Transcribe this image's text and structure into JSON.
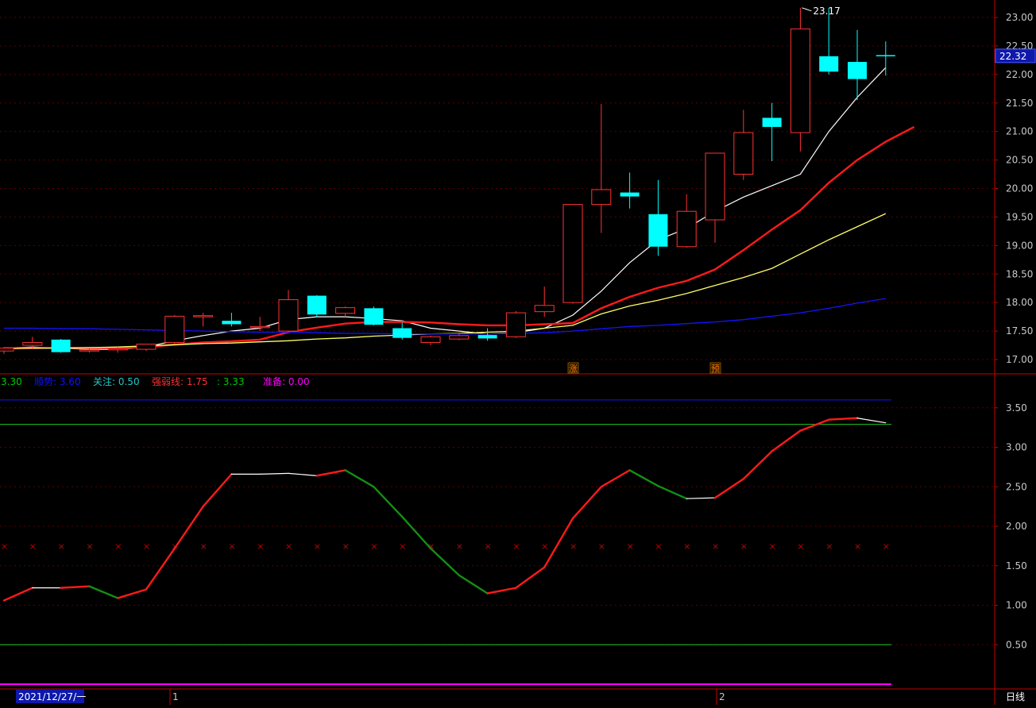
{
  "price_axis_ticks": [
    "23.00",
    "22.50",
    "22.00",
    "21.50",
    "21.00",
    "20.50",
    "20.00",
    "19.50",
    "19.00",
    "18.50",
    "18.00",
    "17.50",
    "17.00"
  ],
  "current_price_label": "22.32",
  "high_annotation": "23.17",
  "candle_markers": [
    {
      "label": "涨",
      "candle_index": 20
    },
    {
      "label": "预",
      "candle_index": 25
    }
  ],
  "indicator_legend": [
    {
      "text": "3.30",
      "color": "#00c800"
    },
    {
      "text": "顺势: 3.60",
      "color": "#1010ff"
    },
    {
      "text": "关注: 0.50",
      "color": "#1ec8c8"
    },
    {
      "text": "强弱线: 1.75",
      "color": "#ff3030"
    },
    {
      "text": ": 3.33",
      "color": "#00c800"
    },
    {
      "text": "准备: 0.00",
      "color": "#ff00ff"
    }
  ],
  "indicator_axis_ticks": [
    "3.50",
    "3.00",
    "2.50",
    "2.00",
    "1.50",
    "1.00",
    "0.50"
  ],
  "time_axis": {
    "date_label": "2021/12/27/一",
    "month_labels": [
      "1",
      "2"
    ]
  },
  "period_label": "日线",
  "colors": {
    "up": "#ff3232",
    "down": "#00ffff",
    "ma5": "#ffffff",
    "ma10": "#ff1a1a",
    "ma20": "#ffff66",
    "ma60": "#1414ff",
    "axis": "#c80000",
    "rising": "#ff1a1a",
    "falling": "#138f13",
    "flat": "#ffffff",
    "guide_blue": "#1414ff",
    "guide_green": "#1ec81e",
    "guide_magenta": "#ff00ff",
    "cross": "#c80000"
  },
  "chart_data": [
    {
      "type": "candlestick",
      "price_range": [
        16.85,
        23.2
      ],
      "candles": [
        {
          "o": 17.15,
          "h": 17.22,
          "l": 17.1,
          "c": 17.2
        },
        {
          "o": 17.25,
          "h": 17.4,
          "l": 17.2,
          "c": 17.3
        },
        {
          "o": 17.35,
          "h": 17.36,
          "l": 17.12,
          "c": 17.13
        },
        {
          "o": 17.16,
          "h": 17.19,
          "l": 17.12,
          "c": 17.17
        },
        {
          "o": 17.17,
          "h": 17.22,
          "l": 17.12,
          "c": 17.19
        },
        {
          "o": 17.18,
          "h": 17.27,
          "l": 17.15,
          "c": 17.27
        },
        {
          "o": 17.3,
          "h": 17.78,
          "l": 17.28,
          "c": 17.76
        },
        {
          "o": 17.77,
          "h": 17.82,
          "l": 17.58,
          "c": 17.77
        },
        {
          "o": 17.68,
          "h": 17.82,
          "l": 17.58,
          "c": 17.62
        },
        {
          "o": 17.58,
          "h": 17.75,
          "l": 17.5,
          "c": 17.58
        },
        {
          "o": 17.5,
          "h": 18.22,
          "l": 17.48,
          "c": 18.05
        },
        {
          "o": 18.12,
          "h": 18.13,
          "l": 17.74,
          "c": 17.79
        },
        {
          "o": 17.81,
          "h": 17.93,
          "l": 17.75,
          "c": 17.91
        },
        {
          "o": 17.9,
          "h": 17.93,
          "l": 17.6,
          "c": 17.61
        },
        {
          "o": 17.55,
          "h": 17.65,
          "l": 17.35,
          "c": 17.38
        },
        {
          "o": 17.3,
          "h": 17.42,
          "l": 17.25,
          "c": 17.4
        },
        {
          "o": 17.36,
          "h": 17.46,
          "l": 17.34,
          "c": 17.42
        },
        {
          "o": 17.43,
          "h": 17.55,
          "l": 17.33,
          "c": 17.37
        },
        {
          "o": 17.4,
          "h": 17.85,
          "l": 17.38,
          "c": 17.82
        },
        {
          "o": 17.84,
          "h": 18.28,
          "l": 17.75,
          "c": 17.95
        },
        {
          "o": 18.0,
          "h": 19.72,
          "l": 17.98,
          "c": 19.72
        },
        {
          "o": 19.72,
          "h": 21.48,
          "l": 19.22,
          "c": 19.98
        },
        {
          "o": 19.93,
          "h": 20.28,
          "l": 19.65,
          "c": 19.86
        },
        {
          "o": 19.55,
          "h": 20.15,
          "l": 18.82,
          "c": 18.98
        },
        {
          "o": 18.98,
          "h": 19.9,
          "l": 18.96,
          "c": 19.6
        },
        {
          "o": 19.45,
          "h": 20.62,
          "l": 19.05,
          "c": 20.62
        },
        {
          "o": 20.25,
          "h": 21.38,
          "l": 20.15,
          "c": 20.98
        },
        {
          "o": 21.24,
          "h": 21.5,
          "l": 20.48,
          "c": 21.08
        },
        {
          "o": 20.98,
          "h": 23.17,
          "l": 20.65,
          "c": 22.8
        },
        {
          "o": 22.32,
          "h": 23.17,
          "l": 22.0,
          "c": 22.05
        },
        {
          "o": 22.22,
          "h": 22.78,
          "l": 21.55,
          "c": 21.92
        },
        {
          "o": 22.34,
          "h": 22.58,
          "l": 21.98,
          "c": 22.32
        }
      ],
      "moving_averages": [
        {
          "key": "ma5",
          "values": [
            17.2,
            17.22,
            17.2,
            17.18,
            17.18,
            17.22,
            17.33,
            17.42,
            17.5,
            17.55,
            17.7,
            17.75,
            17.75,
            17.72,
            17.68,
            17.55,
            17.5,
            17.45,
            17.47,
            17.55,
            17.78,
            18.2,
            18.7,
            19.1,
            19.3,
            19.6,
            19.85,
            20.05,
            20.25,
            21.0,
            21.6,
            22.12
          ]
        },
        {
          "key": "ma10",
          "values": [
            17.2,
            17.2,
            17.21,
            17.2,
            17.2,
            17.22,
            17.26,
            17.3,
            17.32,
            17.35,
            17.48,
            17.56,
            17.63,
            17.66,
            17.66,
            17.65,
            17.62,
            17.6,
            17.6,
            17.62,
            17.64,
            17.9,
            18.1,
            18.26,
            18.38,
            18.58,
            18.92,
            19.28,
            19.62,
            20.1,
            20.5,
            20.82,
            21.08
          ]
        },
        {
          "key": "ma20",
          "values": [
            17.19,
            17.2,
            17.2,
            17.21,
            17.22,
            17.24,
            17.26,
            17.28,
            17.29,
            17.31,
            17.33,
            17.36,
            17.38,
            17.41,
            17.43,
            17.45,
            17.46,
            17.48,
            17.5,
            17.55,
            17.6,
            17.8,
            17.94,
            18.04,
            18.16,
            18.3,
            18.44,
            18.6,
            18.85,
            19.1,
            19.33,
            19.56
          ]
        },
        {
          "key": "ma60",
          "values": [
            17.55,
            17.55,
            17.54,
            17.54,
            17.53,
            17.52,
            17.51,
            17.5,
            17.49,
            17.48,
            17.48,
            17.47,
            17.46,
            17.46,
            17.45,
            17.45,
            17.45,
            17.45,
            17.46,
            17.47,
            17.5,
            17.54,
            17.58,
            17.6,
            17.63,
            17.66,
            17.7,
            17.76,
            17.82,
            17.9,
            17.99,
            18.07
          ]
        }
      ]
    },
    {
      "type": "line",
      "y_range": [
        0.0,
        3.9
      ],
      "strength_line": [
        1.06,
        1.22,
        1.22,
        1.24,
        1.09,
        1.2,
        1.72,
        2.25,
        2.66,
        2.66,
        2.67,
        2.64,
        2.71,
        2.5,
        2.12,
        1.72,
        1.38,
        1.15,
        1.22,
        1.48,
        2.1,
        2.5,
        2.71,
        2.51,
        2.35,
        2.36,
        2.6,
        2.95,
        3.21,
        3.35,
        3.37,
        3.31
      ],
      "guide_lines": [
        {
          "key": "guide_blue",
          "value": 3.6
        },
        {
          "key": "guide_green",
          "value": 3.29
        },
        {
          "key": "guide_green",
          "value": 0.5
        },
        {
          "key": "guide_magenta",
          "value": 0.0
        },
        {
          "key": "cross",
          "value": 1.75
        }
      ]
    }
  ]
}
